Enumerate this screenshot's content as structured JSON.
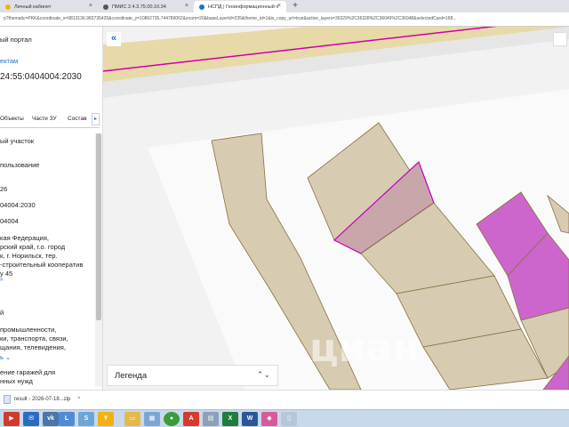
{
  "browser": {
    "tabs": [
      {
        "title": "Личный кабинет",
        "icon_color": "#f4b400"
      },
      {
        "title": "ПМИС 2.4.3.75.00.10.34",
        "icon_color": "#555555"
      },
      {
        "title": "НСПД | Геоинформационный п",
        "icon_color": "#1a73c6"
      }
    ],
    "new_tab_label": "+",
    "address": "p?thematic=PKK&coordinate_x=9813136.983735425&coordinate_y=10862735.744789062&zoom=20&baseLayerId=235&theme_id=1&is_copy_url=true&active_layers=36329%2C36328%2C36049%2C36048&selectedCard=168..."
  },
  "left_panel": {
    "portal_title": "ый портал",
    "objects_link": "ектам",
    "cad_number": "24:55:0404004:2030",
    "tabs": [
      "Объекты",
      "Части ЗУ",
      "Состав"
    ],
    "tabs_next": "▸",
    "fields": [
      {
        "value": "ый участок"
      },
      {
        "value": "пользование"
      },
      {
        "value": "26"
      },
      {
        "value": "04004:2030"
      },
      {
        "value": "04004"
      }
    ],
    "address_lines": [
      "кая Федерация,",
      "рский край, г.о. город",
      "к, г. Норильск, тер.",
      "-строительный кооператив",
      "у 45"
    ],
    "address_more": "^",
    "category_value": "й",
    "category_lines": [
      "промышленности,",
      "ки, транспорта, связи,",
      "щания, телевидения,"
    ],
    "category_more": "ь ⌄",
    "use_lines": [
      "ение гаражей для",
      "нных нужд"
    ]
  },
  "map": {
    "collapse_label": "«",
    "legend_label": "Легенда",
    "legend_arrow": "⌃⌄",
    "watermark": "циан",
    "watermark_id": "958",
    "colors": {
      "background": "#f2f2f2",
      "parcel_fill": "#d7cbb2",
      "parcel_stroke": "#8a7040",
      "selected_fill": "#c9a6a9",
      "selected_stroke": "#c000c0",
      "highlight_fill": "#cc66cc",
      "road_fill": "#e8d9a8",
      "road_line": "#cc00aa"
    }
  },
  "downloads": {
    "file": "result - 2026-07-18...zip",
    "arrow": "^"
  },
  "taskbar": {
    "buttons": [
      {
        "name": "start",
        "label": "▶",
        "color": "#d33a2c"
      },
      {
        "name": "mail",
        "label": "✉",
        "color": "#2a6cc2"
      },
      {
        "name": "vk",
        "label": "vk",
        "color": "#4a76a8"
      },
      {
        "name": "lock",
        "label": "L",
        "color": "#4e8cd4"
      },
      {
        "name": "browser",
        "label": "S",
        "color": "#6aa6d8"
      },
      {
        "name": "yandex",
        "label": "Y",
        "color": "#f2b111"
      },
      {
        "name": "explorer",
        "label": "▭",
        "color": "#e5b84a"
      },
      {
        "name": "gallery",
        "label": "▦",
        "color": "#7aa6d6"
      },
      {
        "name": "chrome",
        "label": "●",
        "color": "#3b9c3b"
      },
      {
        "name": "pdf",
        "label": "A",
        "color": "#d83a2c"
      },
      {
        "name": "app",
        "label": "▤",
        "color": "#8da0b8"
      },
      {
        "name": "excel",
        "label": "X",
        "color": "#1f7d3e"
      },
      {
        "name": "word",
        "label": "W",
        "color": "#2b5797"
      },
      {
        "name": "paint",
        "label": "◆",
        "color": "#d85a9a"
      },
      {
        "name": "folder",
        "label": "▯",
        "color": "#b7c7da"
      }
    ]
  }
}
